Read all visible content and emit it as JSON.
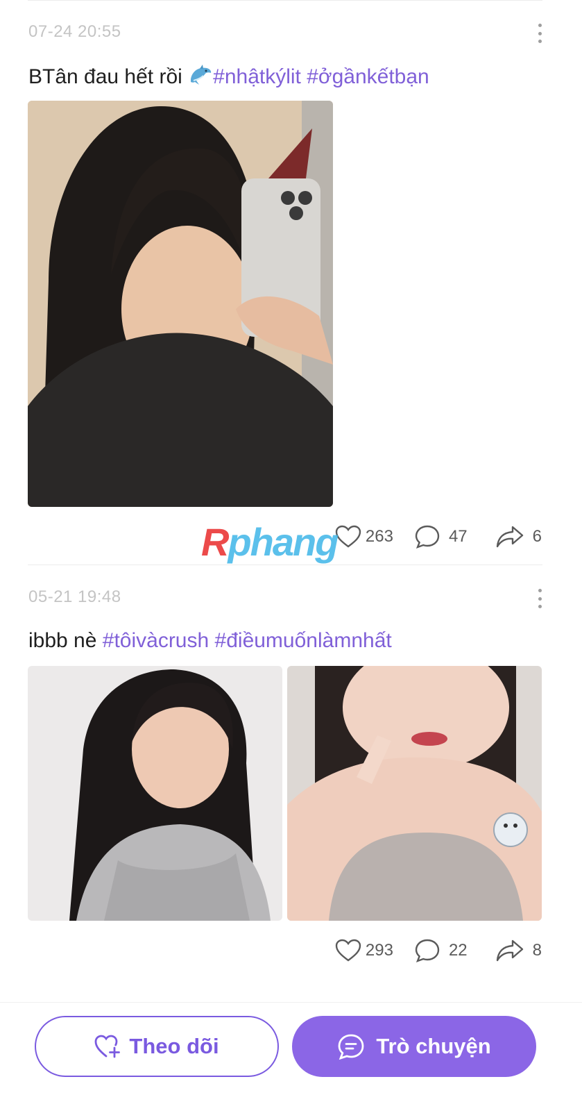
{
  "posts": [
    {
      "time": "07-24 20:55",
      "text": "BTân đau hết rồi ",
      "emoji": "dolphin-emoji",
      "hashtags": [
        "#nhậtkýlit",
        "#ởgầnkếtbạn"
      ],
      "likes": "263",
      "comments": "47",
      "shares": "6"
    },
    {
      "time": "05-21 19:48",
      "text": "ibbb nè ",
      "hashtags": [
        "#tôivàcrush",
        "#điềumuốnlàmnhất"
      ],
      "likes": "293",
      "comments": "22",
      "shares": "8"
    }
  ],
  "watermark": {
    "first": "R",
    "rest": "phang"
  },
  "footer": {
    "follow_label": "Theo dõi",
    "chat_label": "Trò chuyện"
  },
  "colors": {
    "accent": "#8b66e6",
    "hashtag": "#8060d8",
    "timestamp": "#c4c4c4"
  },
  "icons": [
    "more-vertical-icon",
    "heart-icon",
    "comment-icon",
    "share-icon",
    "heart-plus-icon",
    "chat-bubble-icon"
  ]
}
